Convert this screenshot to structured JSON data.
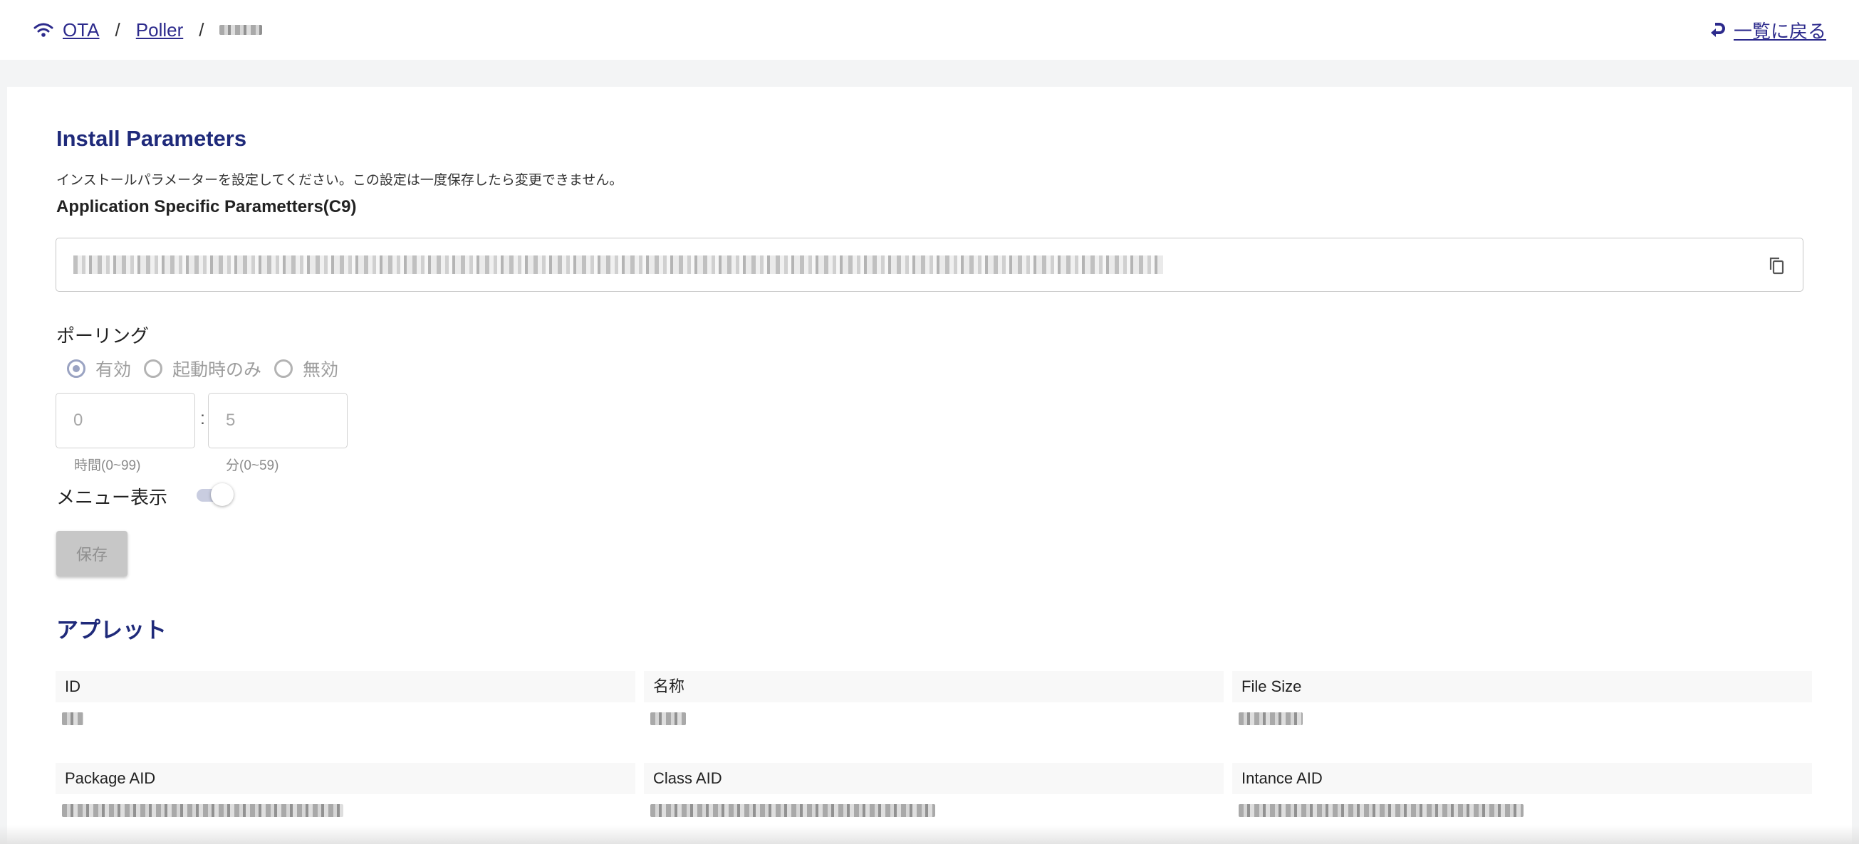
{
  "breadcrumb": {
    "icon": "wifi-icon",
    "items": [
      "OTA",
      "Poller"
    ],
    "separator": "/"
  },
  "back": {
    "icon": "return-arrow-icon",
    "label": "一覧に戻る"
  },
  "install": {
    "title": "Install Parameters",
    "description": "インストールパラメーターを設定してください。この設定は一度保存したら変更できません。",
    "param_label": "Application Specific Parametters(C9)",
    "copy_icon": "copy-icon"
  },
  "polling": {
    "label": "ポーリング",
    "options": [
      "有効",
      "起動時のみ",
      "無効"
    ],
    "selected": "有効",
    "hours_value": "0",
    "minutes_value": "5",
    "colon": ":",
    "hours_hint": "時間(0~99)",
    "minutes_hint": "分(0~59)"
  },
  "menu_display": {
    "label": "メニュー表示",
    "on": true
  },
  "save_label": "保存",
  "applet": {
    "title": "アプレット",
    "fields": [
      "ID",
      "名称",
      "File Size",
      "Package AID",
      "Class AID",
      "Intance AID"
    ]
  },
  "colors": {
    "accent": "#1f2a7a",
    "link": "#2c2a8c"
  }
}
